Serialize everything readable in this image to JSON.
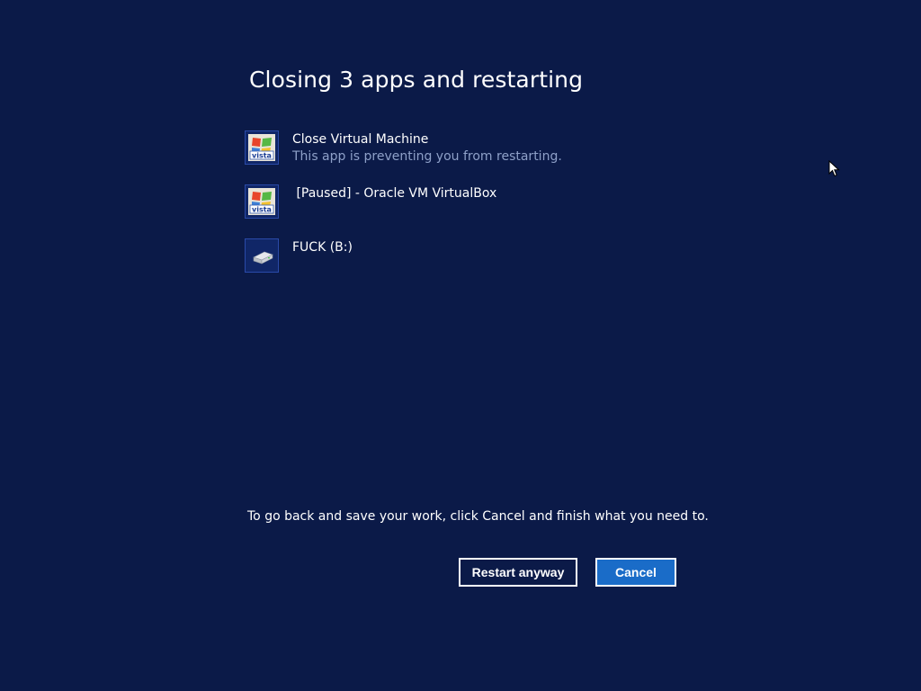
{
  "dialog": {
    "title": "Closing 3 apps and restarting",
    "apps": [
      {
        "name": "Close Virtual Machine",
        "status": "This app is preventing you from restarting.",
        "icon": "vista-logo-icon"
      },
      {
        "name": " [Paused] - Oracle VM VirtualBox",
        "status": "",
        "icon": "vista-logo-icon"
      },
      {
        "name": "FUCK (B:)",
        "status": "",
        "icon": "drive-icon"
      }
    ],
    "note": "To go back and save your work, click Cancel and finish what you need to.",
    "restart_label": "Restart anyway",
    "cancel_label": "Cancel"
  },
  "colors": {
    "background": "#0b1a48",
    "accent": "#1a6cc8",
    "secondary_text": "#8ea0c8"
  }
}
